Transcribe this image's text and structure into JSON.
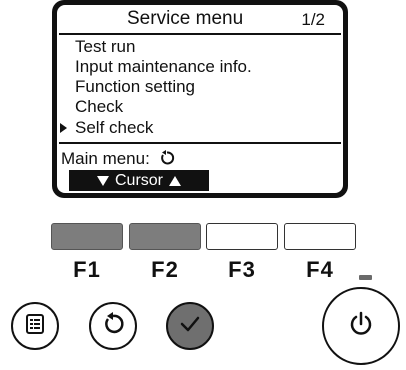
{
  "screen": {
    "title": "Service menu",
    "page": "1/2",
    "items": [
      {
        "label": "Test run"
      },
      {
        "label": "Input maintenance info."
      },
      {
        "label": "Function setting"
      },
      {
        "label": "Check"
      },
      {
        "label": "Self check",
        "selected": true
      }
    ],
    "main_menu_label": "Main menu:",
    "cursor_label": "Cursor"
  },
  "function_keys": [
    {
      "label": "F1",
      "active": true
    },
    {
      "label": "F2",
      "active": true
    },
    {
      "label": "F3",
      "active": false
    },
    {
      "label": "F4",
      "active": false
    }
  ],
  "buttons": [
    {
      "icon": "menu-icon"
    },
    {
      "icon": "return-icon"
    },
    {
      "icon": "confirm-check-icon"
    },
    {
      "icon": "power-icon"
    }
  ],
  "colors": {
    "lcd_frame": "#111111",
    "key_active": "#7d7d7d",
    "confirm_button": "#6f6f6f"
  }
}
